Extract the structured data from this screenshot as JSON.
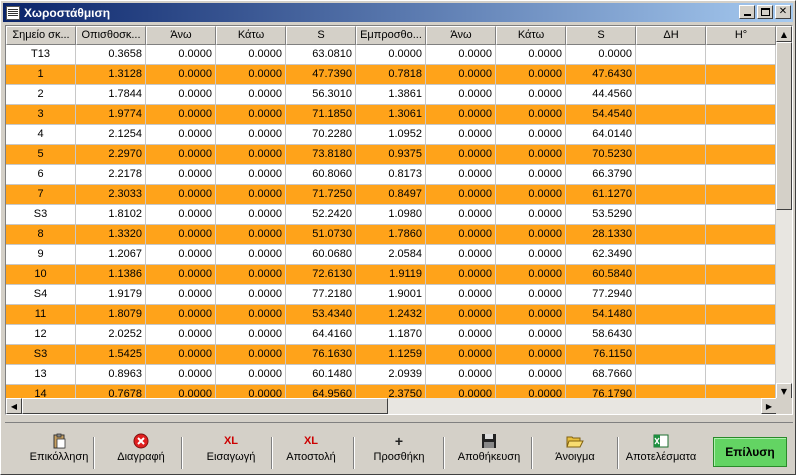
{
  "window": {
    "title": "Χωροστάθμιση"
  },
  "columns": [
    "Σημείο σκ...",
    "Οπισθοσκ...",
    "Άνω",
    "Κάτω",
    "S",
    "Εμπροσθο...",
    "Άνω",
    "Κάτω",
    "S",
    "ΔΗ",
    "Η°"
  ],
  "rows": [
    [
      "T13",
      "0.3658",
      "0.0000",
      "0.0000",
      "63.0810",
      "0.0000",
      "0.0000",
      "0.0000",
      "0.0000",
      "",
      ""
    ],
    [
      "1",
      "1.3128",
      "0.0000",
      "0.0000",
      "47.7390",
      "0.7818",
      "0.0000",
      "0.0000",
      "47.6430",
      "",
      ""
    ],
    [
      "2",
      "1.7844",
      "0.0000",
      "0.0000",
      "56.3010",
      "1.3861",
      "0.0000",
      "0.0000",
      "44.4560",
      "",
      ""
    ],
    [
      "3",
      "1.9774",
      "0.0000",
      "0.0000",
      "71.1850",
      "1.3061",
      "0.0000",
      "0.0000",
      "54.4540",
      "",
      ""
    ],
    [
      "4",
      "2.1254",
      "0.0000",
      "0.0000",
      "70.2280",
      "1.0952",
      "0.0000",
      "0.0000",
      "64.0140",
      "",
      ""
    ],
    [
      "5",
      "2.2970",
      "0.0000",
      "0.0000",
      "73.8180",
      "0.9375",
      "0.0000",
      "0.0000",
      "70.5230",
      "",
      ""
    ],
    [
      "6",
      "2.2178",
      "0.0000",
      "0.0000",
      "60.8060",
      "0.8173",
      "0.0000",
      "0.0000",
      "66.3790",
      "",
      ""
    ],
    [
      "7",
      "2.3033",
      "0.0000",
      "0.0000",
      "71.7250",
      "0.8497",
      "0.0000",
      "0.0000",
      "61.1270",
      "",
      ""
    ],
    [
      "S3",
      "1.8102",
      "0.0000",
      "0.0000",
      "52.2420",
      "1.0980",
      "0.0000",
      "0.0000",
      "53.5290",
      "",
      ""
    ],
    [
      "8",
      "1.3320",
      "0.0000",
      "0.0000",
      "51.0730",
      "1.7860",
      "0.0000",
      "0.0000",
      "28.1330",
      "",
      ""
    ],
    [
      "9",
      "1.2067",
      "0.0000",
      "0.0000",
      "60.0680",
      "2.0584",
      "0.0000",
      "0.0000",
      "62.3490",
      "",
      ""
    ],
    [
      "10",
      "1.1386",
      "0.0000",
      "0.0000",
      "72.6130",
      "1.9119",
      "0.0000",
      "0.0000",
      "60.5840",
      "",
      ""
    ],
    [
      "S4",
      "1.9179",
      "0.0000",
      "0.0000",
      "77.2180",
      "1.9001",
      "0.0000",
      "0.0000",
      "77.2940",
      "",
      ""
    ],
    [
      "11",
      "1.8079",
      "0.0000",
      "0.0000",
      "53.4340",
      "1.2432",
      "0.0000",
      "0.0000",
      "54.1480",
      "",
      ""
    ],
    [
      "12",
      "2.0252",
      "0.0000",
      "0.0000",
      "64.4160",
      "1.1870",
      "0.0000",
      "0.0000",
      "58.6430",
      "",
      ""
    ],
    [
      "S3",
      "1.5425",
      "0.0000",
      "0.0000",
      "76.1630",
      "1.1259",
      "0.0000",
      "0.0000",
      "76.1150",
      "",
      ""
    ],
    [
      "13",
      "0.8963",
      "0.0000",
      "0.0000",
      "60.1480",
      "2.0939",
      "0.0000",
      "0.0000",
      "68.7660",
      "",
      ""
    ],
    [
      "14",
      "0.7678",
      "0.0000",
      "0.0000",
      "64.9560",
      "2.3750",
      "0.0000",
      "0.0000",
      "76.1790",
      "",
      ""
    ]
  ],
  "toolbar": {
    "paste": "Επικόλληση",
    "delete": "Διαγραφή",
    "import": "Εισαγωγή",
    "export": "Αποστολή",
    "add": "Προσθήκη",
    "save": "Αποθήκευση",
    "open": "Άνοιγμα",
    "results": "Αποτελέσματα",
    "solve": "Επίλυση"
  },
  "icons": {
    "xl_import": "XL",
    "xl_export": "XL",
    "add": "+"
  },
  "colors": {
    "row_highlight": "#ffa31a",
    "solve_button": "#63d463",
    "titlebar_start": "#0a246a",
    "titlebar_end": "#a6caf0"
  }
}
